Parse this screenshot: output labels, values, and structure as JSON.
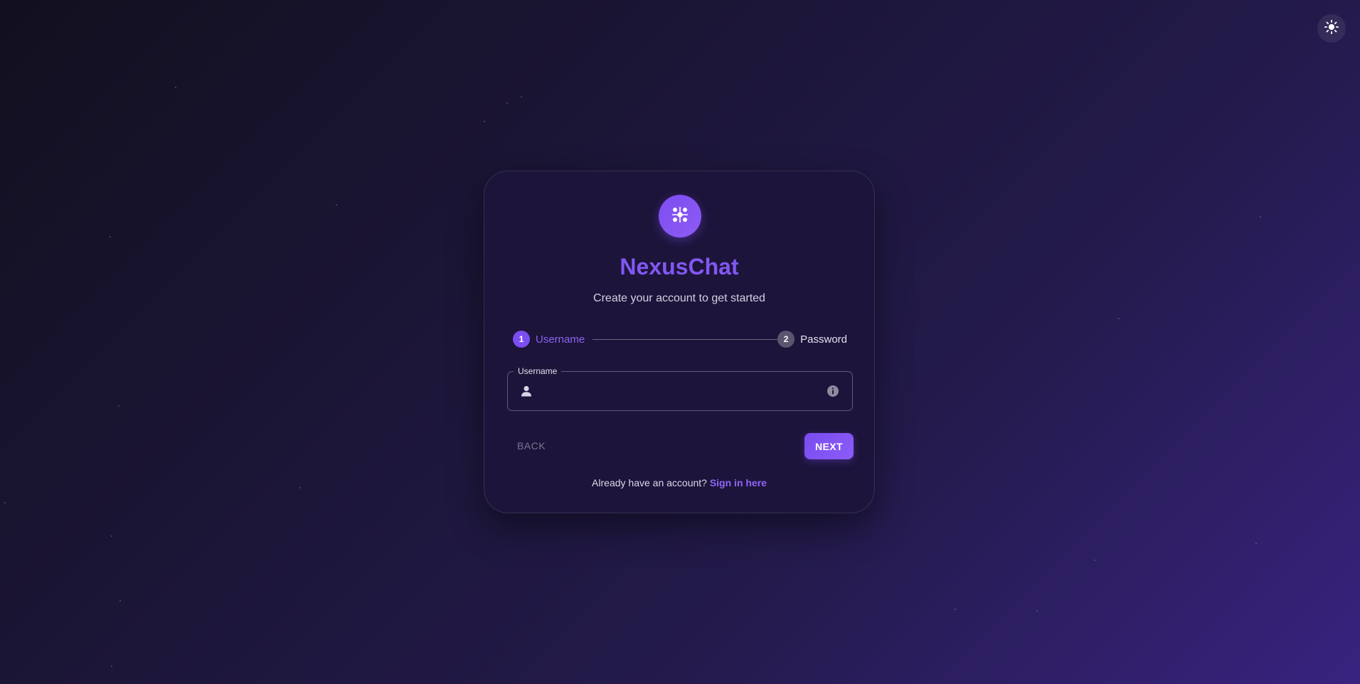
{
  "theme_toggle": {
    "icon": "sun-icon"
  },
  "app": {
    "logo_icon": "nexus-logo-icon",
    "name": "NexusChat",
    "subtitle": "Create your account to get started"
  },
  "stepper": {
    "steps": [
      {
        "number": "1",
        "label": "Username",
        "state": "active"
      },
      {
        "number": "2",
        "label": "Password",
        "state": "inactive"
      }
    ]
  },
  "username_field": {
    "label": "Username",
    "value": "",
    "leading_icon": "person-icon",
    "trailing_icon": "info-icon"
  },
  "buttons": {
    "back_label": "BACK",
    "next_label": "NEXT"
  },
  "footer": {
    "text": "Already have an account?",
    "link_label": "Sign in here"
  },
  "colors": {
    "accent": "#8257f2",
    "background_start": "#12101f",
    "background_end": "#38237f",
    "card": "#1c143a"
  }
}
